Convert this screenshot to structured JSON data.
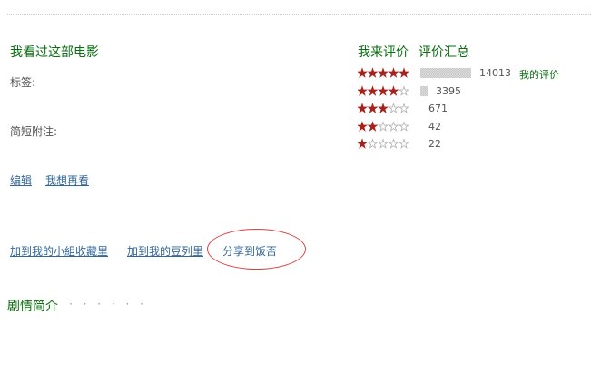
{
  "left": {
    "heading": "我看过这部电影",
    "tags_label": "标签:",
    "note_label": "简短附注:",
    "edit_link": "编辑",
    "want_rewatch_link": "我想再看",
    "add_group_link": "加到我的小組收藏里",
    "add_doulist_link": "加到我的豆列里",
    "share_link": "分享到饭否"
  },
  "right": {
    "my_rating_heading": "我来评价",
    "summary_heading": "评价汇总",
    "my_comment_link": "我的评价",
    "ratings": [
      {
        "stars": 5,
        "count": "14013",
        "fraction": 1.0
      },
      {
        "stars": 4,
        "count": "3395",
        "fraction": 0.14
      },
      {
        "stars": 3,
        "count": "671",
        "fraction": 0.0
      },
      {
        "stars": 2,
        "count": "42",
        "fraction": 0.0
      },
      {
        "stars": 1,
        "count": "22",
        "fraction": 0.0
      }
    ]
  },
  "synopsis": {
    "heading": "剧情简介",
    "dots": "· · · · · ·"
  },
  "colors": {
    "green": "#0b6e10",
    "link": "#336699",
    "star_filled": "#a8221d",
    "star_empty": "#b0b0b0",
    "highlight_ellipse": "#d94040"
  }
}
